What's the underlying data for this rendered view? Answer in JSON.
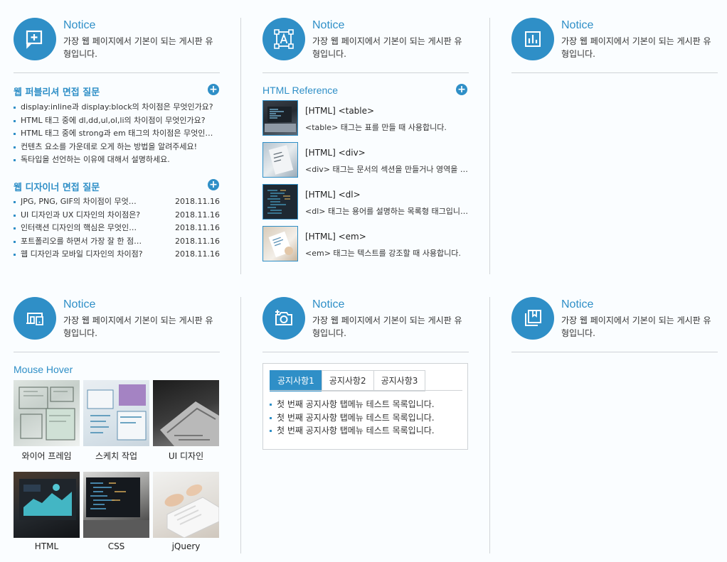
{
  "notice": {
    "title": "Notice",
    "desc": "가장 웹 페이지에서 기본이 되는 게시판 유형입니다."
  },
  "icons": [
    "add-comment-icon",
    "text-frame-icon",
    "chart-icon",
    "devices-icon",
    "add-camera-icon",
    "bookmark-icon"
  ],
  "board1": {
    "title": "웹 퍼블리셔 면접 질문",
    "plus": "+",
    "items": [
      "display:inline과 display:block의 차이점은 무엇인가요?",
      "HTML 태그 중에 dl,dd,ul,ol,li의 차이점이 무엇인가요?",
      "HTML 태그 중에 strong과 em 태그의 차이점은 무엇인가요?",
      "컨텐츠 요소를 가운데로 오게 하는 방법을 알려주세요!",
      "독타입을 선언하는 이유에 대해서 설명하세요."
    ]
  },
  "board2": {
    "title": "웹 디자이너 면접 질문",
    "plus": "+",
    "items": [
      {
        "text": "JPG, PNG, GIF의 차이점이 무엇인가요?",
        "date": "2018.11.16"
      },
      {
        "text": "UI 디자인과 UX 디자인의 차이점은?",
        "date": "2018.11.16"
      },
      {
        "text": "인터랙션 디자인의 핵심은 무엇인가요?",
        "date": "2018.11.16"
      },
      {
        "text": "포트폴리오를 하면서 가장 잘 한 점은?",
        "date": "2018.11.16"
      },
      {
        "text": "웹 디자인과 모바일 디자인의 차이점?",
        "date": "2018.11.16"
      }
    ]
  },
  "reference": {
    "title": "HTML Reference",
    "plus": "+",
    "items": [
      {
        "title": "[HTML] <table>",
        "desc": "<table> 태그는 표를 만들 때 사용합니다."
      },
      {
        "title": "[HTML] <div>",
        "desc": "<div> 태그는 문서의 섹션을 만들거나 영역을 나눌 때 사용합니다."
      },
      {
        "title": "[HTML] <dl>",
        "desc": "<dl> 태그는 용어를 설명하는 목록형 태그입니다."
      },
      {
        "title": "[HTML] <em>",
        "desc": "<em> 태그는 텍스트를 강조할 때 사용합니다."
      }
    ]
  },
  "hover": {
    "title": "Mouse Hover",
    "items": [
      "와이어 프레임",
      "스케치 작업",
      "UI 디자인",
      "HTML",
      "CSS",
      "jQuery"
    ]
  },
  "tabs": {
    "labels": [
      "공지사항1",
      "공지사항2",
      "공지사항3"
    ],
    "active": 0,
    "items": [
      "첫 번째 공지사항 탭메뉴 테스트 목록입니다.",
      "첫 번째 공지사항 탭메뉴 테스트 목록입니다.",
      "첫 번째 공지사항 탭메뉴 테스트 목록입니다."
    ]
  },
  "colors": {
    "accent": "#2f8fc7",
    "divider": "#d2d6d9",
    "background": "#fafdff"
  }
}
